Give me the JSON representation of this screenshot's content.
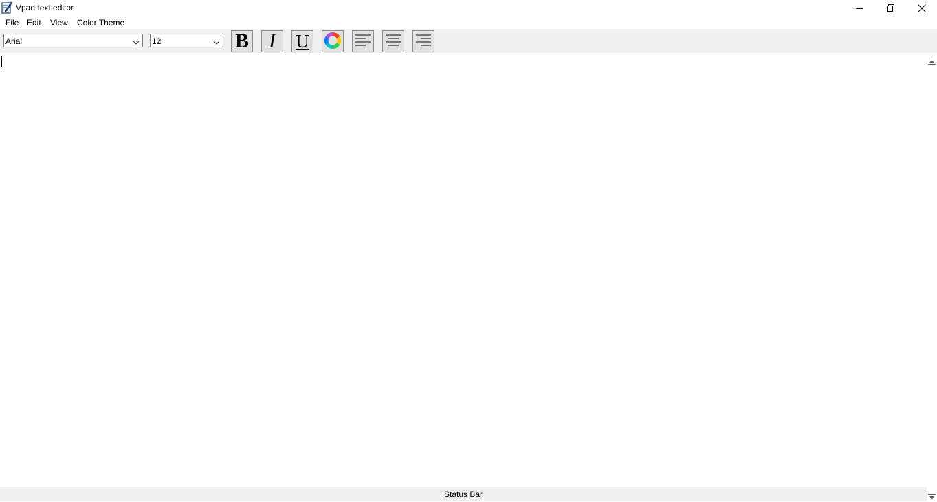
{
  "window": {
    "title": "Vpad text editor",
    "controls": [
      "minimize-icon",
      "restore-icon",
      "close-icon"
    ]
  },
  "menu": {
    "items": [
      "File",
      "Edit",
      "View",
      "Color Theme"
    ]
  },
  "toolbar": {
    "font_family": {
      "value": "Arial"
    },
    "font_size": {
      "value": "12"
    },
    "buttons": {
      "bold": "B",
      "italic": "I",
      "underline": "U",
      "color": "color-wheel-icon",
      "align_left": "align-left-icon",
      "align_center": "align-center-icon",
      "align_right": "align-right-icon"
    }
  },
  "editor": {
    "content": ""
  },
  "status_bar": {
    "text": "Status Bar"
  },
  "colors": {
    "toolbar_bg": "#f0f0f0",
    "button_bg": "#e1e1e1",
    "editor_bg": "#ffffff"
  }
}
